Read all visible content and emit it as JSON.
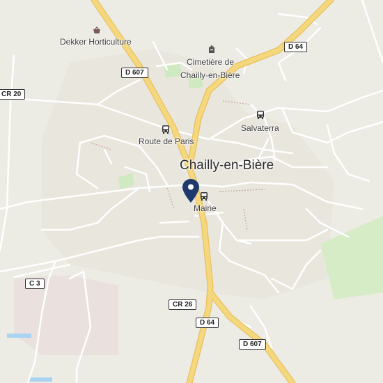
{
  "map": {
    "town_label": "Chailly-en-Bière",
    "pois": {
      "horticulture": "Dekker Horticulture",
      "cemetery_line1": "Cimetière de",
      "cemetery_line2": "Chailly-en-Bière",
      "salvaterra": "Salvaterra",
      "route_de_paris": "Route de Paris",
      "mairie": "Mairie"
    },
    "road_shields": {
      "d607_north": "D 607",
      "d64_northeast": "D 64",
      "cr20": "CR 20",
      "c3": "C 3",
      "cr26": "CR 26",
      "d64_south": "D 64",
      "d607_south": "D 607"
    },
    "icons": {
      "horticulture": "shopping-basket-icon",
      "cemetery": "cemetery-icon",
      "bus_stops": "bus-icon",
      "selected_location": "map-pin-icon"
    },
    "colors": {
      "background": "#ecebe4",
      "major_road": "#f5d77e",
      "major_road_edge": "#e8c15c",
      "minor_road": "#ffffff",
      "green_area": "#d5ecc6",
      "pin": "#1e3a6d"
    }
  }
}
